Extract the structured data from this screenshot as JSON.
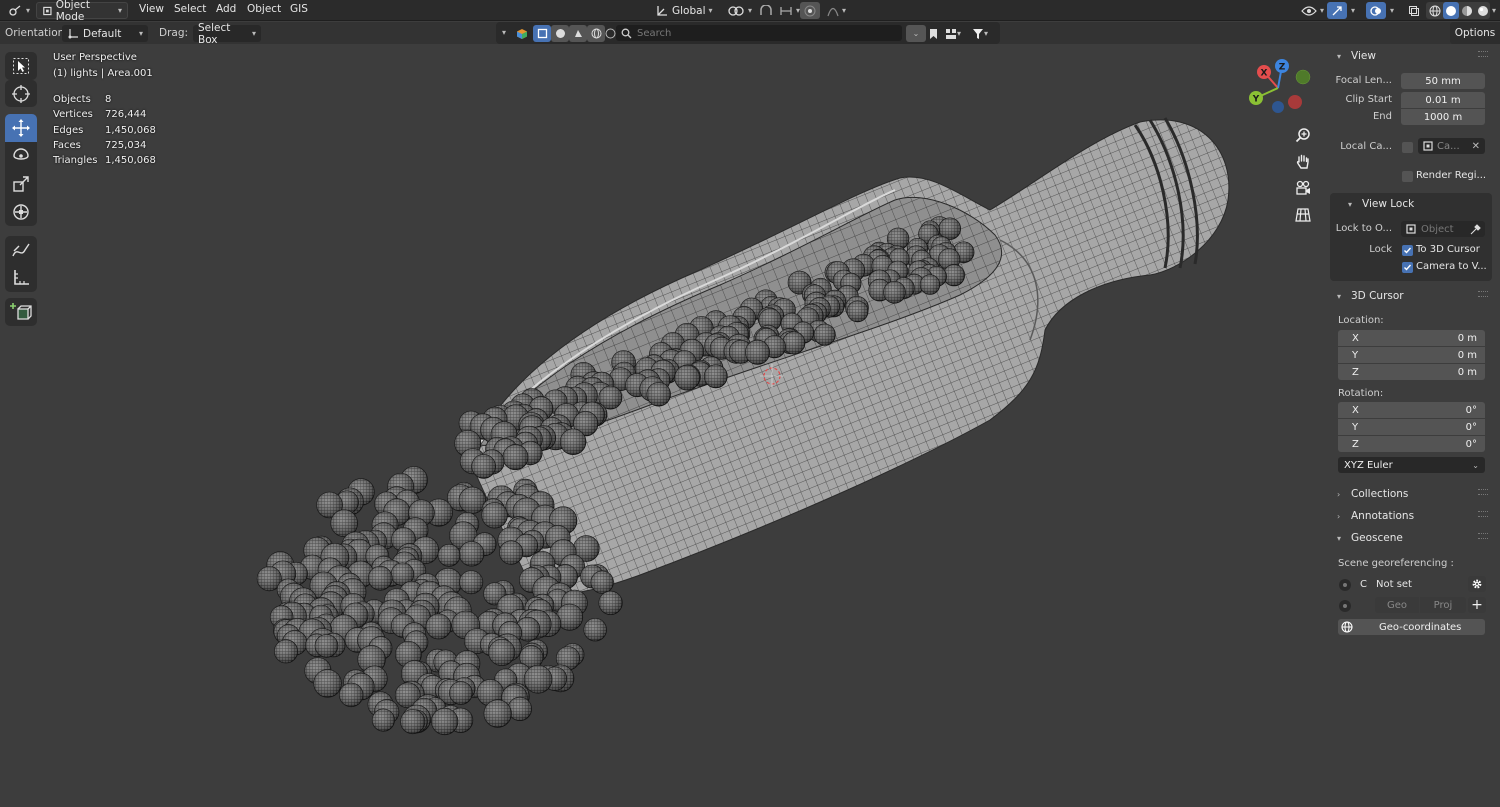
{
  "header": {
    "mode": "Object Mode",
    "menus": [
      "View",
      "Select",
      "Add",
      "Object",
      "GIS"
    ],
    "transform_orientation": "Global"
  },
  "tool_settings": {
    "orientation_label": "Orientation:",
    "orientation_value": "Default",
    "drag_label": "Drag:",
    "drag_value": "Select Box",
    "search_placeholder": "Search",
    "options_label": "Options"
  },
  "viewport": {
    "view_name": "User Perspective",
    "object_info": "(1) lights | Area.001",
    "stats": [
      {
        "label": "Objects",
        "value": "8"
      },
      {
        "label": "Vertices",
        "value": "726,444"
      },
      {
        "label": "Edges",
        "value": "1,450,068"
      },
      {
        "label": "Faces",
        "value": "725,034"
      },
      {
        "label": "Triangles",
        "value": "1,450,068"
      }
    ],
    "gizmo_axes": {
      "x": "X",
      "y": "Y",
      "z": "Z"
    }
  },
  "sidebar": {
    "view": {
      "title": "View",
      "focal_label": "Focal Len...",
      "focal_value": "50 mm",
      "clip_start_label": "Clip Start",
      "clip_start_value": "0.01 m",
      "end_label": "End",
      "end_value": "1000 m",
      "local_camera_label": "Local Ca...",
      "local_camera_value": "Ca...",
      "render_region_label": "Render Regi...",
      "view_lock_title": "View Lock",
      "lock_to_object_label": "Lock to O...",
      "lock_to_object_placeholder": "Object",
      "lock_label": "Lock",
      "to_3d_cursor_label": "To 3D Cursor",
      "camera_to_view_label": "Camera to V..."
    },
    "cursor": {
      "title": "3D Cursor",
      "location_label": "Location:",
      "location": [
        {
          "axis": "X",
          "value": "0 m"
        },
        {
          "axis": "Y",
          "value": "0 m"
        },
        {
          "axis": "Z",
          "value": "0 m"
        }
      ],
      "rotation_label": "Rotation:",
      "rotation": [
        {
          "axis": "X",
          "value": "0°"
        },
        {
          "axis": "Y",
          "value": "0°"
        },
        {
          "axis": "Z",
          "value": "0°"
        }
      ],
      "rotation_mode": "XYZ Euler"
    },
    "collections_title": "Collections",
    "annotations_title": "Annotations",
    "geoscene": {
      "title": "Geoscene",
      "georef_label": "Scene georeferencing :",
      "crs_prefix": "C",
      "crs_value": "Not set",
      "geo_label": "Geo",
      "proj_label": "Proj",
      "geocoords_label": "Geo-coordinates"
    }
  },
  "colors": {
    "accent": "#4772b3",
    "viewport_bg": "#3d3d3d",
    "header_bg": "#2b2b2b",
    "axis_x": "#e44d4d",
    "axis_y": "#8bc034",
    "axis_z": "#3d85e0"
  },
  "icons": [
    "editor-type-icon",
    "object-mode-icon",
    "orientation-icon",
    "snap-icon",
    "proportional-icon",
    "select-tool-icon",
    "cursor-tool-icon",
    "move-tool-icon",
    "rotate-tool-icon",
    "scale-tool-icon",
    "transform-tool-icon",
    "annotate-tool-icon",
    "measure-tool-icon",
    "add-cube-tool-icon",
    "zoom-icon",
    "hand-icon",
    "camera-icon",
    "grid-icon",
    "gear-icon",
    "globe-icon"
  ]
}
